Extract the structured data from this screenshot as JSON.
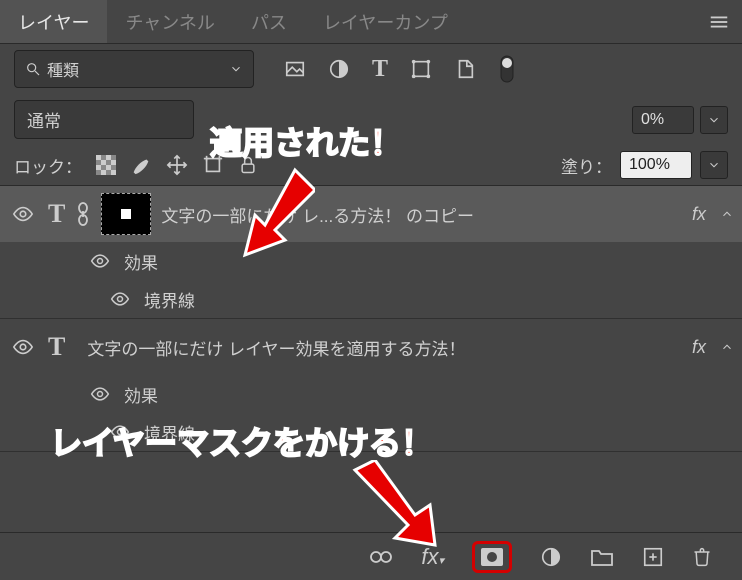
{
  "tabs": [
    "レイヤー",
    "チャンネル",
    "パス",
    "レイヤーカンプ"
  ],
  "activeTab": 0,
  "filter": {
    "label": "種類"
  },
  "blend": {
    "mode": "通常",
    "opacityValue": "0%"
  },
  "lock": {
    "label": "ロック：",
    "fillLabel": "塗り：",
    "fillValue": "100%"
  },
  "layers": [
    {
      "name": "文字の一部にだけ レ...る方法！ のコピー",
      "hasMask": true,
      "selected": true,
      "effects": {
        "title": "効果",
        "items": [
          "境界線"
        ]
      }
    },
    {
      "name": "文字の一部にだけ レイヤー効果を適用する方法！",
      "hasMask": false,
      "selected": false,
      "effects": {
        "title": "効果",
        "items": [
          "境界線"
        ]
      }
    }
  ],
  "fxLabel": "fx",
  "annotations": {
    "applied": "適用された！",
    "addMask": "レイヤーマスクをかける！"
  }
}
